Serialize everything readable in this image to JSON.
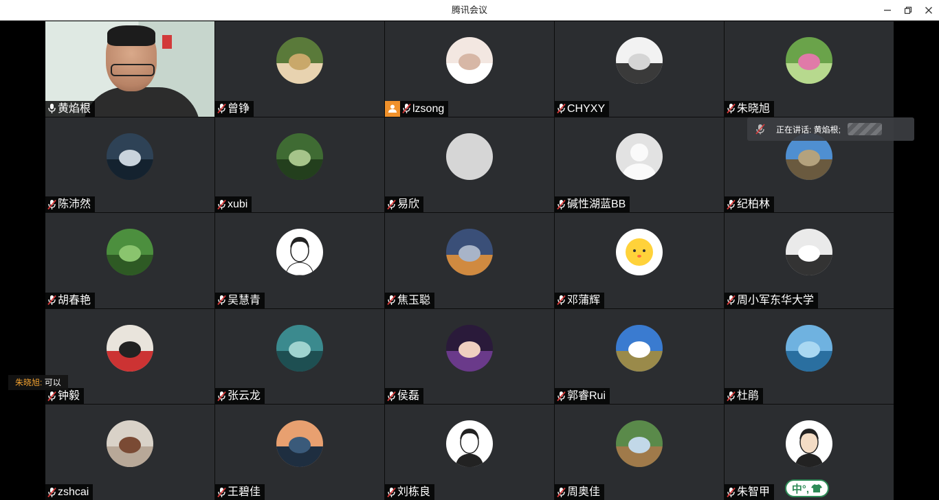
{
  "window": {
    "title": "腾讯会议",
    "minimize_icon": "minimize-icon",
    "restore_icon": "restore-icon",
    "close_icon": "close-icon"
  },
  "participants": [
    {
      "name": "黄焰根",
      "mic": "on",
      "video": true,
      "active": true
    },
    {
      "name": "曾铮",
      "mic": "muted",
      "avatar": "dog-photo"
    },
    {
      "name": "lzsong",
      "mic": "muted",
      "avatar": "dancer-photo",
      "badge": "host-user-icon"
    },
    {
      "name": "CHYXY",
      "mic": "muted",
      "avatar": "gallery-photo"
    },
    {
      "name": "朱晓旭",
      "mic": "muted",
      "avatar": "lotus-photo"
    },
    {
      "name": "陈沛然",
      "mic": "muted",
      "avatar": "warship-photo"
    },
    {
      "name": "xubi",
      "mic": "muted",
      "avatar": "forest-photo"
    },
    {
      "name": "易欣",
      "mic": "muted",
      "avatar": "grey-blank"
    },
    {
      "name": "碱性湖蓝BB",
      "mic": "muted",
      "avatar": "default-person"
    },
    {
      "name": "纪柏林",
      "mic": "muted",
      "avatar": "cliff-photo"
    },
    {
      "name": "胡春艳",
      "mic": "muted",
      "avatar": "leaves-photo"
    },
    {
      "name": "吴慧青",
      "mic": "muted",
      "avatar": "sketch-girl"
    },
    {
      "name": "焦玉聪",
      "mic": "muted",
      "avatar": "desk-photo"
    },
    {
      "name": "邓蒲辉",
      "mic": "muted",
      "avatar": "sun-cartoon"
    },
    {
      "name": "周小军东华大学",
      "mic": "muted",
      "avatar": "sports-car"
    },
    {
      "name": "钟毅",
      "mic": "muted",
      "avatar": "penguin-art"
    },
    {
      "name": "张云龙",
      "mic": "muted",
      "avatar": "teal-text-photo"
    },
    {
      "name": "侯磊",
      "mic": "muted",
      "avatar": "eggs-cartoon"
    },
    {
      "name": "郭睿Rui",
      "mic": "muted",
      "avatar": "grassland-sky"
    },
    {
      "name": "杜鹃",
      "mic": "muted",
      "avatar": "sea-sky"
    },
    {
      "name": "zshcai",
      "mic": "muted",
      "avatar": "teapot-photo"
    },
    {
      "name": "王碧佳",
      "mic": "muted",
      "avatar": "sunset-lake"
    },
    {
      "name": "刘栋良",
      "mic": "muted",
      "avatar": "portrait-sketch"
    },
    {
      "name": "周奥佳",
      "mic": "muted",
      "avatar": "park-photo"
    },
    {
      "name": "朱智甲",
      "mic": "muted",
      "avatar": "cartoon-man"
    }
  ],
  "speaking": {
    "label": "正在讲话: 黄焰根;"
  },
  "chat": {
    "sender": "朱晓旭:",
    "message": "可以"
  },
  "ime": {
    "text": "中°,",
    "icon": "shirt-icon"
  },
  "colors": {
    "tile_bg": "#2b2d30",
    "active_border": "#2fbf71",
    "muted_red": "#d93a3a",
    "badge_orange": "#f0912b",
    "chat_sender": "#f0a030"
  }
}
